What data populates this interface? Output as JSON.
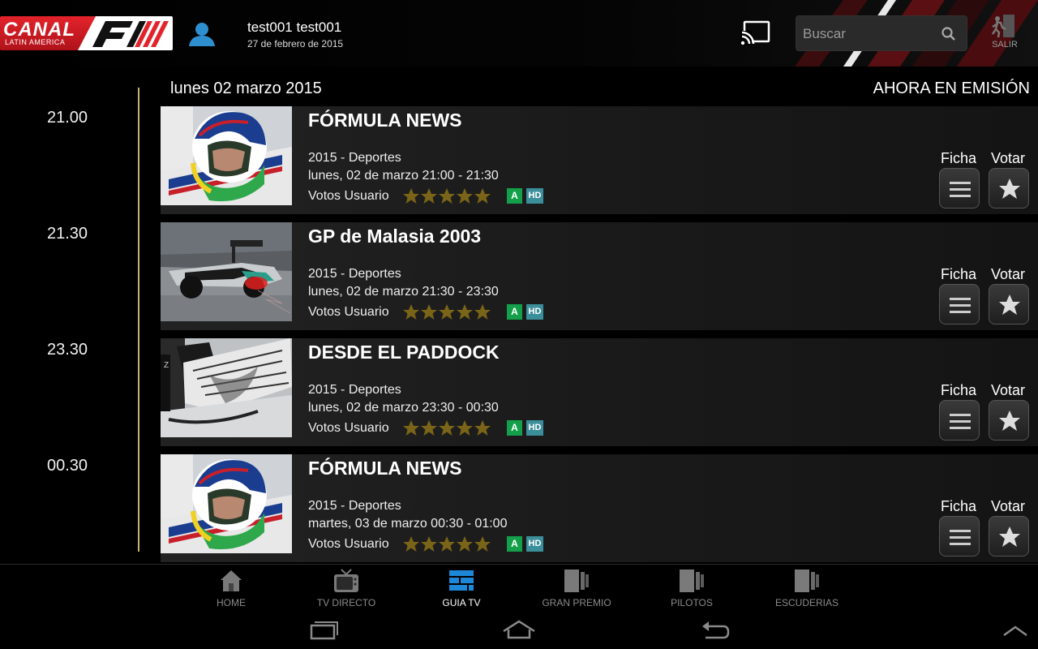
{
  "header": {
    "logo": {
      "brand": "CANAL",
      "region": "LATIN AMERICA",
      "mark": "F1"
    },
    "user_name": "test001 test001",
    "user_date": "27 de febrero de 2015",
    "search_placeholder": "Buscar",
    "exit_label": "SALIR"
  },
  "datebar": {
    "date": "lunes 02 marzo 2015",
    "now_label": "AHORA EN EMISIÓN"
  },
  "schedule": [
    {
      "time": "21.00",
      "title": "FÓRMULA NEWS",
      "meta1": "2015 - Deportes",
      "meta2": "lunes, 02 de marzo 21:00 - 21:30",
      "votes_label": "Votos Usuario",
      "rating": 5,
      "badge_a": "A",
      "badge_hd": "HD",
      "ficha": "Ficha",
      "votar": "Votar"
    },
    {
      "time": "21.30",
      "title": "GP de Malasia 2003",
      "meta1": "2015 - Deportes",
      "meta2": "lunes, 02 de marzo 21:30 - 23:30",
      "votes_label": "Votos Usuario",
      "rating": 5,
      "badge_a": "A",
      "badge_hd": "HD",
      "ficha": "Ficha",
      "votar": "Votar"
    },
    {
      "time": "23.30",
      "title": "DESDE EL PADDOCK",
      "meta1": "2015 - Deportes",
      "meta2": "lunes, 02 de marzo 23:30 - 00:30",
      "votes_label": "Votos Usuario",
      "rating": 5,
      "badge_a": "A",
      "badge_hd": "HD",
      "ficha": "Ficha",
      "votar": "Votar"
    },
    {
      "time": "00.30",
      "title": "FÓRMULA NEWS",
      "meta1": "2015 - Deportes",
      "meta2": "martes, 03 de marzo 00:30 - 01:00",
      "votes_label": "Votos Usuario",
      "rating": 5,
      "badge_a": "A",
      "badge_hd": "HD",
      "ficha": "Ficha",
      "votar": "Votar"
    }
  ],
  "bottomnav": [
    {
      "label": "HOME",
      "icon": "home-icon",
      "active": false
    },
    {
      "label": "TV DIRECTO",
      "icon": "tv-icon",
      "active": false
    },
    {
      "label": "GUIA TV",
      "icon": "guide-icon",
      "active": true
    },
    {
      "label": "GRAN PREMIO",
      "icon": "gran-premio-icon",
      "active": false
    },
    {
      "label": "PILOTOS",
      "icon": "pilotos-icon",
      "active": false
    },
    {
      "label": "ESCUDERIAS",
      "icon": "escuderias-icon",
      "active": false
    }
  ],
  "colors": {
    "accent_red": "#d81f26",
    "guide_active": "#1e88d8",
    "star_gold": "#7a6418",
    "badge_a": "#14a04a",
    "badge_hd": "#3b8f9a",
    "timeline": "#c9b27a"
  }
}
